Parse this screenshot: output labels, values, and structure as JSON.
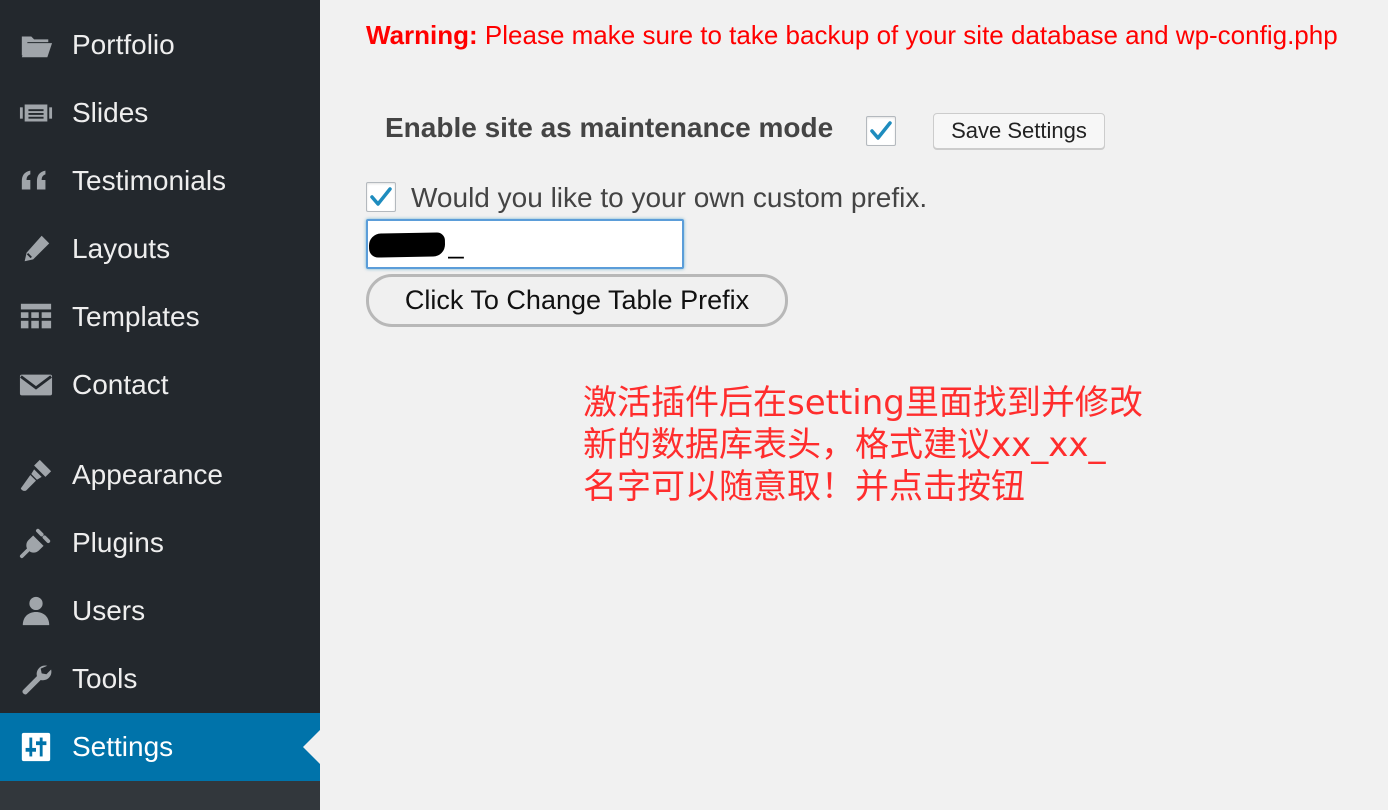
{
  "sidebar": {
    "items": [
      {
        "label": "Portfolio",
        "icon": "folder-icon"
      },
      {
        "label": "Slides",
        "icon": "slides-icon"
      },
      {
        "label": "Testimonials",
        "icon": "quote-icon"
      },
      {
        "label": "Layouts",
        "icon": "pencil-icon"
      },
      {
        "label": "Templates",
        "icon": "grid-icon"
      },
      {
        "label": "Contact",
        "icon": "envelope-icon"
      },
      {
        "label": "Appearance",
        "icon": "paintbrush-icon"
      },
      {
        "label": "Plugins",
        "icon": "plug-icon"
      },
      {
        "label": "Users",
        "icon": "user-icon"
      },
      {
        "label": "Tools",
        "icon": "wrench-icon"
      },
      {
        "label": "Settings",
        "icon": "sliders-icon",
        "active": true
      }
    ]
  },
  "main": {
    "warning_prefix": "Warning:",
    "warning_text": "Please make sure to take backup of your site database and wp-config.php",
    "maintenance_label": "Enable site as maintenance mode",
    "maintenance_checked": true,
    "save_button": "Save Settings",
    "custom_prefix_label": "Would you like to your own custom prefix.",
    "custom_prefix_checked": true,
    "prefix_input_value": "_",
    "change_button": "Click To Change Table Prefix",
    "annotation_lines": [
      "激活插件后在setting里面找到并修改",
      "新的数据库表头，格式建议xx_xx_",
      "名字可以随意取！并点击按钮"
    ]
  },
  "colors": {
    "sidebar_bg": "#23282d",
    "active_bg": "#0073aa",
    "warning": "#ff0000",
    "annotation": "#ff2d2d",
    "checkmark": "#1e8cbe"
  }
}
